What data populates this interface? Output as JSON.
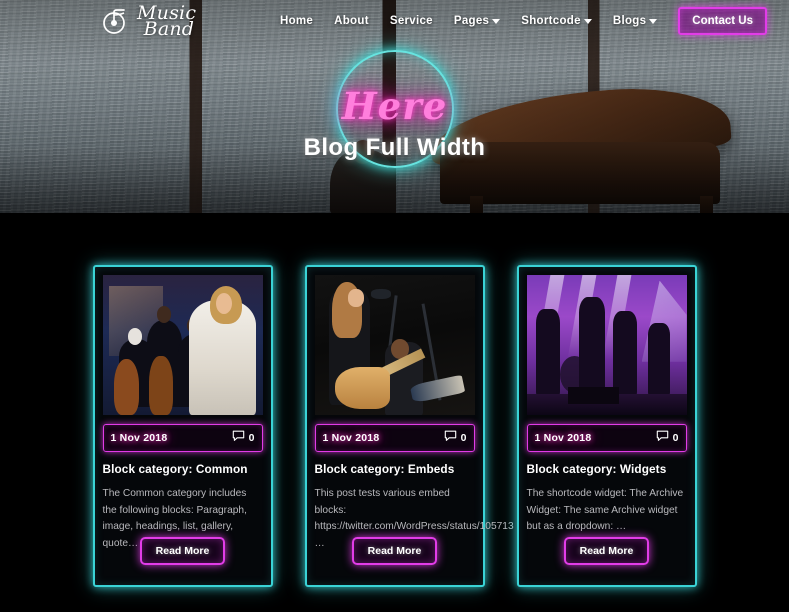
{
  "site": {
    "logo_line1": "Music",
    "logo_line2": "Band",
    "logo_icon": "music-note-circle-icon"
  },
  "nav": {
    "items": [
      {
        "label": "Home",
        "has_dropdown": false
      },
      {
        "label": "About",
        "has_dropdown": false
      },
      {
        "label": "Service",
        "has_dropdown": false
      },
      {
        "label": "Pages",
        "has_dropdown": true
      },
      {
        "label": "Shortcode",
        "has_dropdown": true
      },
      {
        "label": "Blogs",
        "has_dropdown": true
      }
    ],
    "cta_label": "Contact Us"
  },
  "hero": {
    "script_text": "Here",
    "title": "Blog Full Width",
    "ring_color": "#3fd8d4",
    "script_color": "#ff7fdc"
  },
  "colors": {
    "page_background": "#000000",
    "card_border": "#3ad3d6",
    "accent_magenta": "#e23ce8",
    "neon_pink": "#ff3ec8",
    "text_primary": "#ffffff",
    "text_muted": "#b9b9bd"
  },
  "posts": [
    {
      "date": "1 Nov 2018",
      "comment_icon": "comment-bubble-icon",
      "comment_count": "0",
      "title": "Block category: Common",
      "excerpt": "The Common category includes the following blocks: Paragraph, image, headings, list, gallery, quote…",
      "read_more_label": "Read More",
      "image_alt": "jazz-band-singer-photo"
    },
    {
      "date": "1 Nov 2018",
      "comment_icon": "comment-bubble-icon",
      "comment_count": "0",
      "title": "Block category: Embeds",
      "excerpt_intro": "This post tests various embed blocks:",
      "excerpt_url": "https://twitter.com/WordPress/status/105713",
      "excerpt_tail": "…",
      "read_more_label": "Read More",
      "image_alt": "guitarist-live-photo"
    },
    {
      "date": "1 Nov 2018",
      "comment_icon": "comment-bubble-icon",
      "comment_count": "0",
      "title": "Block category: Widgets",
      "excerpt": "The shortcode widget: The Archive Widget: The same Archive widget but as a dropdown: …",
      "read_more_label": "Read More",
      "image_alt": "rock-band-stage-photo"
    }
  ]
}
